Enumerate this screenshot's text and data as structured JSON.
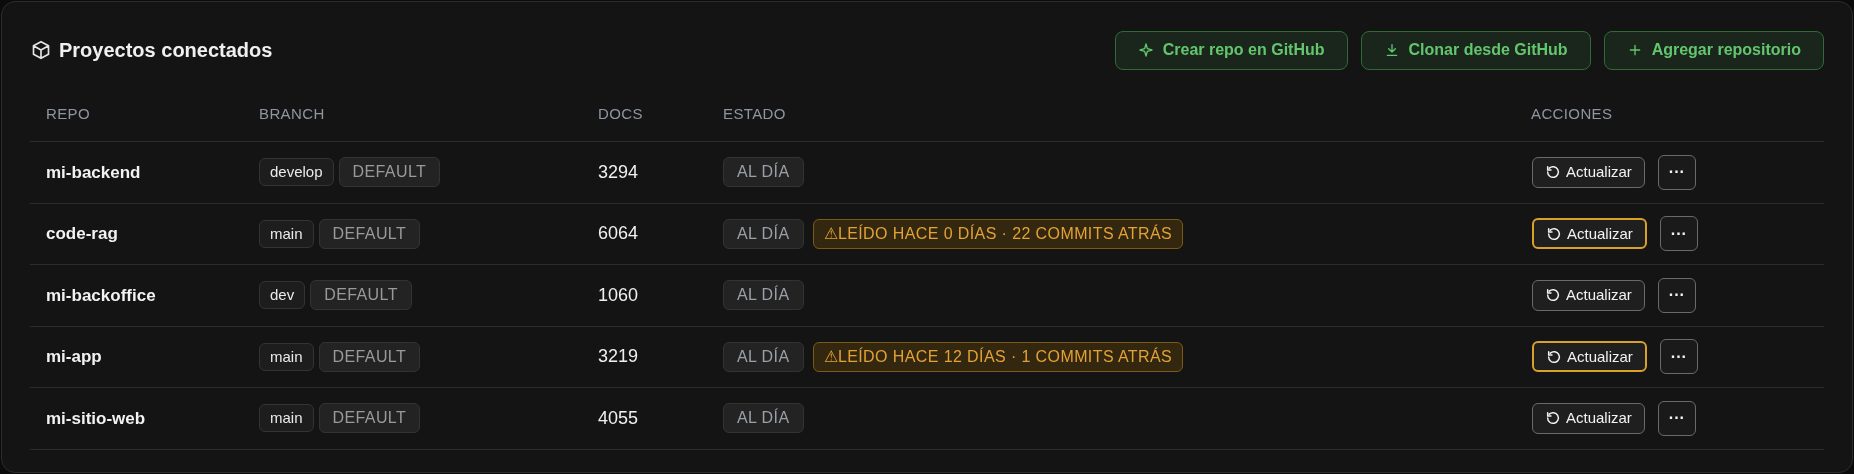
{
  "panel": {
    "title": "Proyectos conectados"
  },
  "actions": [
    {
      "kind": "sparkle",
      "label": "Crear repo en GitHub"
    },
    {
      "kind": "download",
      "label": "Clonar desde GitHub"
    },
    {
      "kind": "plus",
      "label": "Agregar repositorio"
    }
  ],
  "table": {
    "columns": [
      "REPO",
      "BRANCH",
      "DOCS",
      "ESTADO",
      "ACCIONES"
    ],
    "rows": [
      {
        "repo": "mi-backend",
        "branch": "develop",
        "branch_tag": "DEFAULT",
        "docs": "3294",
        "status": "AL DÍA",
        "update": {
          "label": "Actualizar",
          "highlighted": false
        },
        "more": "···"
      },
      {
        "repo": "code-rag",
        "branch": "main",
        "branch_tag": "DEFAULT",
        "docs": "6064",
        "status": "AL DÍA",
        "warning": "⚠LEÍDO HACE 0 DÍAS · 22 COMMITS ATRÁS",
        "update": {
          "label": "Actualizar",
          "highlighted": true
        },
        "more": "···"
      },
      {
        "repo": "mi-backoffice",
        "branch": "dev",
        "branch_tag": "DEFAULT",
        "docs": "1060",
        "status": "AL DÍA",
        "update": {
          "label": "Actualizar",
          "highlighted": false
        },
        "more": "···"
      },
      {
        "repo": "mi-app",
        "branch": "main",
        "branch_tag": "DEFAULT",
        "docs": "3219",
        "status": "AL DÍA",
        "warning": "⚠LEÍDO HACE 12 DÍAS · 1 COMMITS ATRÁS",
        "update": {
          "label": "Actualizar",
          "highlighted": true
        },
        "more": "···"
      },
      {
        "repo": "mi-sitio-web",
        "branch": "main",
        "branch_tag": "DEFAULT",
        "docs": "4055",
        "status": "AL DÍA",
        "update": {
          "label": "Actualizar",
          "highlighted": false
        },
        "more": "···"
      }
    ]
  }
}
